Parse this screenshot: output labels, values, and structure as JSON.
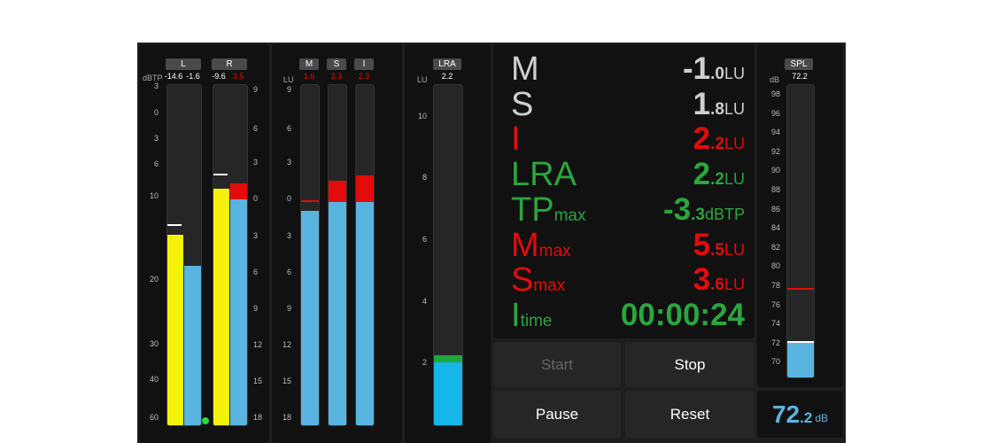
{
  "colors": {
    "red": "#e40b0b",
    "green": "#2aa63d",
    "white": "#e6e6e6",
    "cyan": "#3aa8d8",
    "yellow": "#f4f20b",
    "blue": "#5ab4e0"
  },
  "tp_meter": {
    "unit": "dBTP",
    "left_ticks": [
      "3",
      "0",
      "3",
      "6",
      "10",
      "20",
      "30",
      "40",
      "60"
    ],
    "right_ticks": [
      "9",
      "6",
      "3",
      "0",
      "3",
      "6",
      "9",
      "12",
      "15",
      "18"
    ],
    "channels": [
      {
        "name": "L",
        "peak1": "-14.6",
        "peak2": "-1.6",
        "level_fraction": 0.56,
        "loud_fraction": 0.47,
        "hold_fraction": 0.585
      },
      {
        "name": "R",
        "peak1": "-9.6",
        "peak2": "3.5",
        "level_fraction": 0.695,
        "loud_fraction": 0.665,
        "red_fraction": 0.045,
        "hold_fraction": 0.735
      }
    ],
    "indicator_color": "#22dd33"
  },
  "loudness_meter": {
    "unit": "LU",
    "ticks": [
      "9",
      "6",
      "3",
      "0",
      "3",
      "6",
      "9",
      "12",
      "15",
      "18"
    ],
    "channels": [
      {
        "name": "M",
        "value": "1.6",
        "fill_fraction": 0.63
      },
      {
        "name": "S",
        "value": "2.3",
        "fill_fraction": 0.655,
        "red_fraction": 0.065
      },
      {
        "name": "I",
        "value": "2.3",
        "fill_fraction": 0.655,
        "red_fraction": 0.08
      }
    ]
  },
  "lra_meter": {
    "name": "LRA",
    "value": "2.2",
    "unit": "LU",
    "ticks": [
      "10",
      "8",
      "6",
      "4",
      "2"
    ],
    "fill_fraction": 0.185,
    "green_fraction": 0.02
  },
  "readouts": [
    {
      "label": "M",
      "sub": "",
      "big": "-1",
      "small": ".0",
      "unit": "LU",
      "color": "white"
    },
    {
      "label": "S",
      "sub": "",
      "big": "1",
      "small": ".8",
      "unit": "LU",
      "color": "white"
    },
    {
      "label": "I",
      "sub": "",
      "big": "2",
      "small": ".2",
      "unit": "LU",
      "color": "red"
    },
    {
      "label": "LRA",
      "sub": "",
      "big": "2",
      "small": ".2",
      "unit": "LU",
      "color": "green"
    },
    {
      "label": "TP",
      "sub": "max",
      "big": "-3",
      "small": ".3",
      "unit": "dBTP",
      "color": "green"
    },
    {
      "label": "M",
      "sub": "max",
      "big": "5",
      "small": ".5",
      "unit": "LU",
      "color": "red"
    },
    {
      "label": "S",
      "sub": "max",
      "big": "3",
      "small": ".6",
      "unit": "LU",
      "color": "red"
    },
    {
      "label": "I",
      "sub": "time",
      "big": "00:00:24",
      "small": "",
      "unit": "",
      "color": "green"
    }
  ],
  "buttons": {
    "start": "Start",
    "stop": "Stop",
    "pause": "Pause",
    "reset": "Reset"
  },
  "spl_meter": {
    "name": "SPL",
    "value": "72.2",
    "unit": "dB",
    "ticks": [
      "98",
      "96",
      "94",
      "92",
      "90",
      "88",
      "86",
      "84",
      "82",
      "80",
      "78",
      "76",
      "74",
      "72",
      "70"
    ],
    "fill_fraction": 0.118,
    "marker_fraction": 0.3,
    "readout_big": "72",
    "readout_small": ".2",
    "readout_unit": "dB"
  }
}
